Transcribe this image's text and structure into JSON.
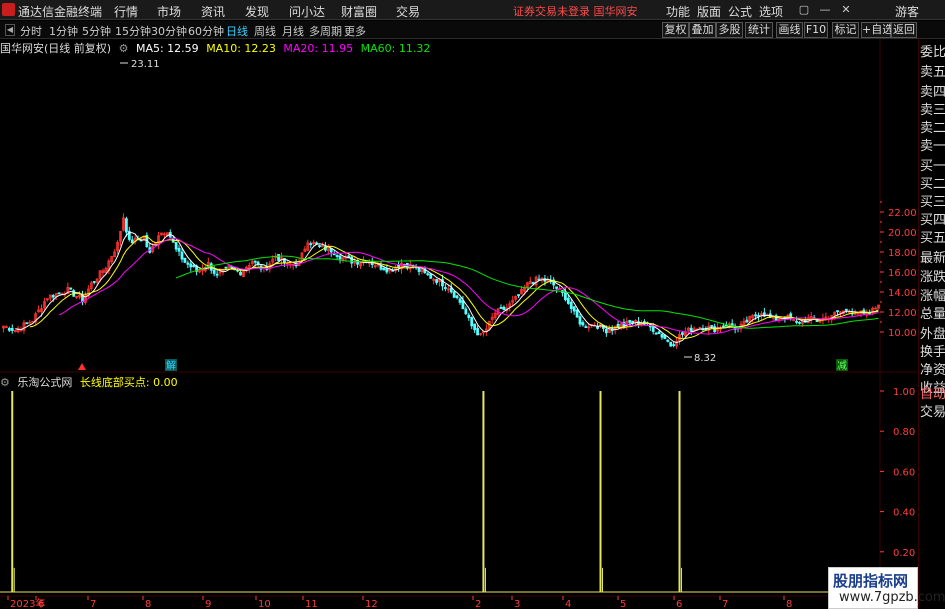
{
  "menubar": {
    "app_title": "通达信金融终端",
    "items": [
      "行情",
      "市场",
      "资讯",
      "发现",
      "问小达",
      "财富圈",
      "交易"
    ],
    "warning": "证券交易未登录  国华网安",
    "right_items": [
      "功能",
      "版面",
      "公式",
      "选项"
    ],
    "guest": "游客"
  },
  "tabbar": {
    "tabs": [
      "分时",
      "1分钟",
      "5分钟",
      "15分钟",
      "30分钟",
      "60分钟",
      "日线",
      "周线",
      "月线",
      "多周期",
      "更多"
    ],
    "active": "日线",
    "right_buttons": [
      "复权",
      "叠加",
      "多股",
      "统计",
      "画线",
      "F10",
      "标记",
      "+自选",
      "返回"
    ]
  },
  "sidebar": {
    "items": [
      "委比",
      "卖五",
      "卖四",
      "卖三",
      "卖二",
      "卖一",
      "买一",
      "买二",
      "买三",
      "买四",
      "买五",
      "最新",
      "涨跌",
      "涨幅",
      "总量",
      "外盘",
      "换手",
      "净资",
      "收益"
    ],
    "bottom": [
      "自动",
      "交易"
    ]
  },
  "main_legend": {
    "stock": "国华网安(日线 前复权)",
    "ma5": "MA5: 12.59",
    "ma10": "MA10: 12.23",
    "ma20": "MA20: 11.95",
    "ma60": "MA60: 11.32"
  },
  "indicator_legend": {
    "name": "乐淘公式网",
    "line": "长线底部买点: 0.00"
  },
  "colors": {
    "up": "#ff3232",
    "down": "#54ffff",
    "ma5": "#ffffff",
    "ma10": "#ffff00",
    "ma20": "#ff00ff",
    "ma60": "#00e600",
    "signal": "#e6e65a",
    "axis_text": "#ff3c3c",
    "grid": "#3a0000"
  },
  "chart_data": [
    {
      "type": "line",
      "title": "国华网安(日线 前复权)",
      "ylabel": "",
      "ylim": [
        8,
        23
      ],
      "y_ticks": [
        10.0,
        12.0,
        14.0,
        16.0,
        18.0,
        20.0,
        22.0
      ],
      "x_tick_labels": [
        "2023年",
        "6",
        "7",
        "8",
        "9",
        "10",
        "11",
        "12",
        "2",
        "3",
        "4",
        "5",
        "6",
        "7",
        "8",
        "9"
      ],
      "annotations": [
        {
          "label": "23.11",
          "kind": "high"
        },
        {
          "label": "8.32",
          "kind": "low"
        },
        {
          "label": "解",
          "kind": "marker"
        },
        {
          "label": "减",
          "kind": "marker"
        }
      ],
      "series": [
        {
          "name": "MA5",
          "latest": 12.59
        },
        {
          "name": "MA10",
          "latest": 12.23
        },
        {
          "name": "MA20",
          "latest": 11.95
        },
        {
          "name": "MA60",
          "latest": 11.32
        }
      ],
      "anchors": [
        [
          0,
          10.6
        ],
        [
          4,
          10.2
        ],
        [
          10,
          11.2
        ],
        [
          15,
          13.5
        ],
        [
          22,
          14.2
        ],
        [
          27,
          13.2
        ],
        [
          30,
          14.8
        ],
        [
          35,
          16.5
        ],
        [
          39,
          18.8
        ],
        [
          41,
          21.5
        ],
        [
          43,
          19.0
        ],
        [
          48,
          19.4
        ],
        [
          50,
          17.8
        ],
        [
          53,
          19.8
        ],
        [
          56,
          20.2
        ],
        [
          59,
          18.2
        ],
        [
          62,
          17.0
        ],
        [
          66,
          16.1
        ],
        [
          70,
          16.8
        ],
        [
          73,
          15.6
        ],
        [
          77,
          16.4
        ],
        [
          81,
          16.0
        ],
        [
          85,
          17.1
        ],
        [
          89,
          16.2
        ],
        [
          93,
          17.6
        ],
        [
          97,
          16.7
        ],
        [
          101,
          16.9
        ],
        [
          104,
          19.2
        ],
        [
          108,
          18.5
        ],
        [
          112,
          18.2
        ],
        [
          116,
          17.4
        ],
        [
          120,
          17.0
        ],
        [
          124,
          17.2
        ],
        [
          128,
          16.6
        ],
        [
          132,
          16.2
        ],
        [
          136,
          16.9
        ],
        [
          140,
          16.5
        ],
        [
          144,
          15.8
        ],
        [
          148,
          15.2
        ],
        [
          152,
          14.5
        ],
        [
          156,
          13.0
        ],
        [
          160,
          10.6
        ],
        [
          163,
          9.6
        ],
        [
          165,
          10.3
        ],
        [
          168,
          11.9
        ],
        [
          172,
          12.4
        ],
        [
          176,
          13.6
        ],
        [
          180,
          15.1
        ],
        [
          184,
          15.3
        ],
        [
          188,
          14.7
        ],
        [
          192,
          13.5
        ],
        [
          195,
          11.8
        ],
        [
          198,
          10.6
        ],
        [
          202,
          10.8
        ],
        [
          206,
          10.2
        ],
        [
          210,
          10.6
        ],
        [
          214,
          10.9
        ],
        [
          218,
          11.0
        ],
        [
          222,
          10.3
        ],
        [
          226,
          9.4
        ],
        [
          228,
          8.7
        ],
        [
          231,
          9.6
        ],
        [
          235,
          10.3
        ],
        [
          239,
          10.6
        ],
        [
          243,
          10.3
        ],
        [
          247,
          10.8
        ],
        [
          251,
          10.3
        ],
        [
          255,
          11.3
        ],
        [
          259,
          12.0
        ],
        [
          263,
          11.2
        ],
        [
          267,
          11.6
        ],
        [
          271,
          10.9
        ],
        [
          275,
          11.3
        ],
        [
          279,
          11.2
        ],
        [
          283,
          11.7
        ],
        [
          287,
          12.1
        ],
        [
          291,
          12.1
        ],
        [
          295,
          11.6
        ],
        [
          299,
          12.7
        ]
      ]
    },
    {
      "type": "bar",
      "title": "乐淘公式网",
      "series_name": "长线底部买点",
      "ylim": [
        0,
        1.0
      ],
      "y_ticks": [
        0.2,
        0.4,
        0.6,
        0.8,
        1.0
      ],
      "signal_bars": [
        3,
        164,
        204,
        231
      ],
      "signal_value": 1.0,
      "latest": 0.0
    }
  ]
}
